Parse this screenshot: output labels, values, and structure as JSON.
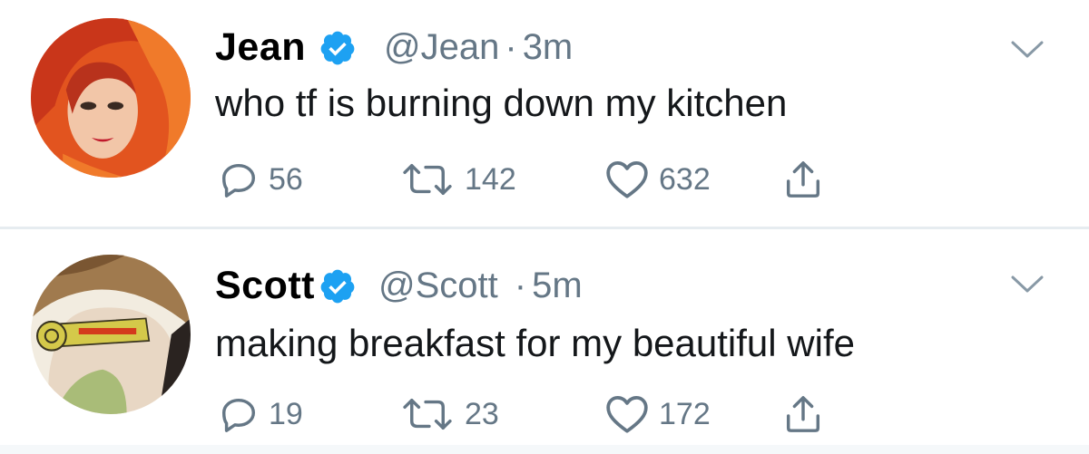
{
  "tweets": [
    {
      "name": "Jean",
      "handle": "@Jean",
      "separator": "·",
      "time": "3m",
      "text": "who tf is burning down my kitchen",
      "replies": "56",
      "retweets": "142",
      "likes": "632"
    },
    {
      "name": "Scott",
      "handle": "@Scott",
      "separator": "·",
      "time": "5m",
      "text": "making breakfast for my beautiful wife",
      "replies": "19",
      "retweets": "23",
      "likes": "172"
    }
  ],
  "colors": {
    "verified_blue": "#1da1f2",
    "secondary_text": "#657786",
    "divider": "#e6ecf0"
  },
  "icons": [
    "reply-icon",
    "retweet-icon",
    "like-icon",
    "share-icon",
    "verified-badge-icon",
    "chevron-down-icon"
  ]
}
